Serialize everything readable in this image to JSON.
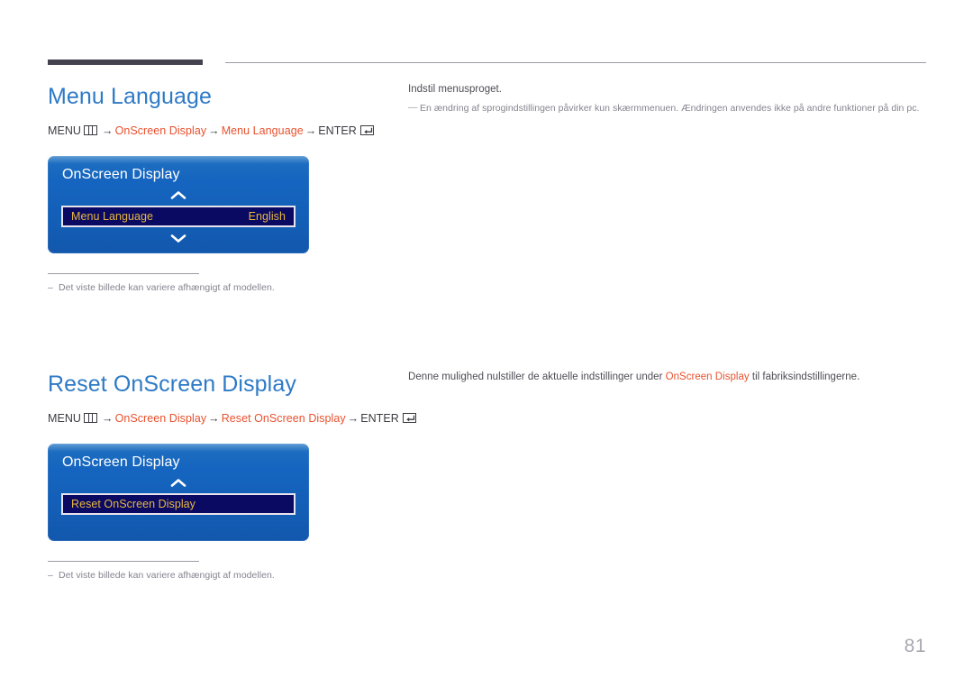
{
  "page": {
    "number": "81"
  },
  "sections": [
    {
      "heading": "Menu Language",
      "breadcrumb": {
        "menu_label": "MENU",
        "menu_icon": "menu-grid-icon",
        "arrow": "→",
        "step1": "OnScreen Display",
        "step2": "Menu Language",
        "enter_label": "ENTER",
        "enter_icon": "enter-return-icon"
      },
      "osd": {
        "title": "OnScreen Display",
        "chevron_up_icon": "chevron-up-icon",
        "chevron_down_icon": "chevron-down-icon",
        "has_chevron_down": true,
        "row": {
          "label": "Menu Language",
          "value": "English"
        }
      },
      "note": {
        "dash": "–",
        "text": "Det viste billede kan variere afhængigt af modellen."
      },
      "description": {
        "title": "Indstil menusproget.",
        "note_dash": "—",
        "note": "En ændring af sprogindstillingen påvirker kun skærmmenuen. Ændringen anvendes ikke på andre funktioner på din pc.",
        "body_before": "",
        "body_accent": "",
        "body_after": ""
      }
    },
    {
      "heading": "Reset OnScreen Display",
      "breadcrumb": {
        "menu_label": "MENU",
        "menu_icon": "menu-grid-icon",
        "arrow": "→",
        "step1": "OnScreen Display",
        "step2": "Reset OnScreen Display",
        "enter_label": "ENTER",
        "enter_icon": "enter-return-icon"
      },
      "osd": {
        "title": "OnScreen Display",
        "chevron_up_icon": "chevron-up-icon",
        "chevron_down_icon": "chevron-down-icon",
        "has_chevron_down": false,
        "row": {
          "label": "Reset OnScreen Display",
          "value": ""
        }
      },
      "note": {
        "dash": "–",
        "text": "Det viste billede kan variere afhængigt af modellen."
      },
      "description": {
        "title": "",
        "note_dash": "",
        "note": "",
        "body_before": "Denne mulighed nulstiller de aktuelle indstillinger under ",
        "body_accent": "OnScreen Display",
        "body_after": " til fabriksindstillingerne."
      }
    }
  ],
  "colors": {
    "heading_blue": "#2f7ac6",
    "accent_orange": "#e8522f",
    "osd_blue": "#1565c0",
    "osd_row_navy": "#0a0a62",
    "osd_row_text": "#e7b73f",
    "rule_dark": "#43424e",
    "body_gray": "#4d4d55",
    "muted_gray": "#86838f"
  }
}
